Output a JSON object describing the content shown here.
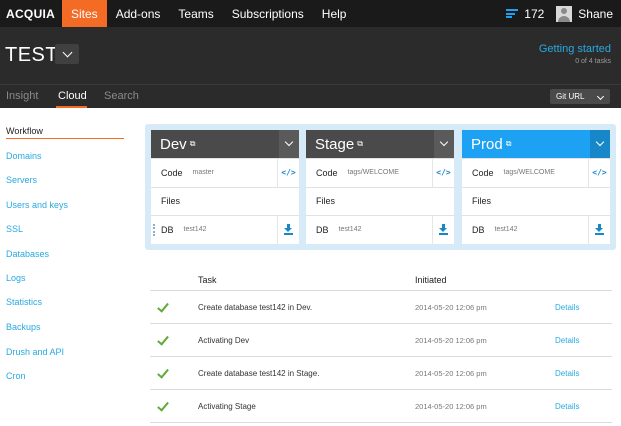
{
  "topnav": {
    "logo": "ACQUIA",
    "items": [
      {
        "label": "Sites",
        "active": true
      },
      {
        "label": "Add-ons",
        "active": false
      },
      {
        "label": "Teams",
        "active": false
      },
      {
        "label": "Subscriptions",
        "active": false
      },
      {
        "label": "Help",
        "active": false
      }
    ],
    "task_count": "172",
    "user_name": "Shane"
  },
  "site": {
    "title": "TEST",
    "getting_started": "Getting started",
    "tasks_progress": "0 of 4 tasks"
  },
  "subtabs": [
    {
      "label": "Insight",
      "active": false
    },
    {
      "label": "Cloud",
      "active": true
    },
    {
      "label": "Search",
      "active": false
    }
  ],
  "git_url_label": "Git URL",
  "sidebar": {
    "heading": "Workflow",
    "items": [
      "Domains",
      "Servers",
      "Users and keys",
      "SSL",
      "Databases",
      "Logs",
      "Statistics",
      "Backups",
      "Drush and API",
      "Cron"
    ]
  },
  "environments": [
    {
      "name": "Dev",
      "code_label": "Code",
      "code_value": "master",
      "files_label": "Files",
      "db_label": "DB",
      "db_value": "test142",
      "header_color": "#4a4a4a"
    },
    {
      "name": "Stage",
      "code_label": "Code",
      "code_value": "tags/WELCOME",
      "files_label": "Files",
      "db_label": "DB",
      "db_value": "test142",
      "header_color": "#4a4a4a"
    },
    {
      "name": "Prod",
      "code_label": "Code",
      "code_value": "tags/WELCOME",
      "files_label": "Files",
      "db_label": "DB",
      "db_value": "test142",
      "header_color": "#1da1f2"
    }
  ],
  "task_table": {
    "col_task": "Task",
    "col_initiated": "Initiated",
    "rows": [
      {
        "task": "Create database test142 in Dev.",
        "initiated": "2014-05-20 12:06 pm",
        "link": "Details"
      },
      {
        "task": "Activating Dev",
        "initiated": "2014-05-20 12:06 pm",
        "link": "Details"
      },
      {
        "task": "Create database test142 in Stage.",
        "initiated": "2014-05-20 12:06 pm",
        "link": "Details"
      },
      {
        "task": "Activating Stage",
        "initiated": "2014-05-20 12:06 pm",
        "link": "Details"
      }
    ]
  },
  "colors": {
    "accent_orange": "#f36b25",
    "link_blue": "#29a9e1",
    "success_green": "#5fa83a",
    "dark_bg": "#2b2b2b"
  }
}
